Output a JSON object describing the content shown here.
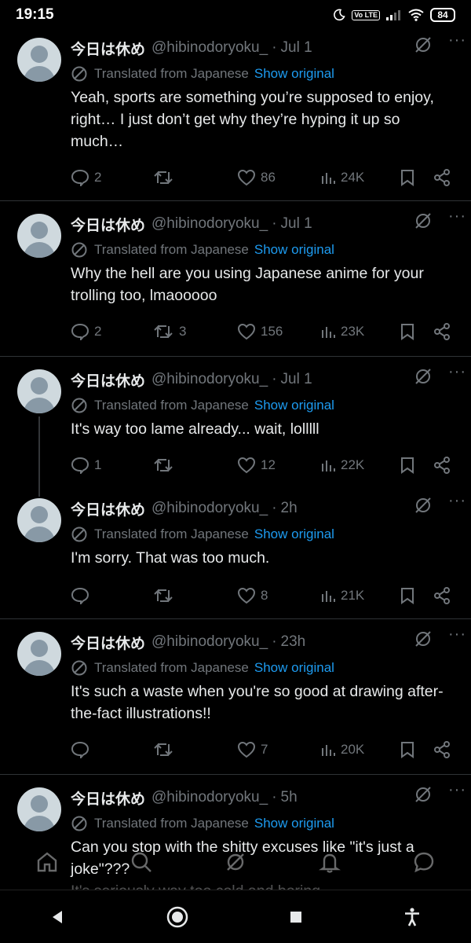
{
  "status_bar": {
    "time": "19:15",
    "volte": "Vo LTE",
    "battery": "84"
  },
  "tweets": [
    {
      "name": "今日は休め",
      "handle": "@hibinodoryoku_",
      "time": "Jul 1",
      "translated": "Translated from Japanese",
      "show_original": "Show original",
      "text": "Yeah, sports are something you’re supposed to enjoy, right… I just don’t get why they’re hyping it up so much…",
      "replies": "2",
      "retweets": "",
      "likes": "86",
      "views": "24K"
    },
    {
      "name": "今日は休め",
      "handle": "@hibinodoryoku_",
      "time": "Jul 1",
      "translated": "Translated from Japanese",
      "show_original": "Show original",
      "text": "Why the hell are you using Japanese anime for your trolling too, lmaooooo",
      "replies": "2",
      "retweets": "3",
      "likes": "156",
      "views": "23K"
    },
    {
      "name": "今日は休め",
      "handle": "@hibinodoryoku_",
      "time": "Jul 1",
      "translated": "Translated from Japanese",
      "show_original": "Show original",
      "text": "It's way too lame already... wait, lolllll",
      "replies": "1",
      "retweets": "",
      "likes": "12",
      "views": "22K"
    },
    {
      "name": "今日は休め",
      "handle": "@hibinodoryoku_",
      "time": "2h",
      "translated": "Translated from Japanese",
      "show_original": "Show original",
      "text": "I'm sorry. That was too much.",
      "replies": "",
      "retweets": "",
      "likes": "8",
      "views": "21K"
    },
    {
      "name": "今日は休め",
      "handle": "@hibinodoryoku_",
      "time": "23h",
      "translated": "Translated from Japanese",
      "show_original": "Show original",
      "text": "It's such a waste when you're so good at drawing after-the-fact illustrations!!",
      "replies": "",
      "retweets": "",
      "likes": "7",
      "views": "20K"
    },
    {
      "name": "今日は休め",
      "handle": "@hibinodoryoku_",
      "time": "5h",
      "translated": "Translated from Japanese",
      "show_original": "Show original",
      "text": "Can you stop with the shitty excuses like \"it's just a joke\"???",
      "text_cut": "It's seriously way too cold and boring"
    }
  ],
  "icons": {
    "grok": "grok-icon",
    "more": "more-icon",
    "translate": "translate-icon",
    "reply": "reply-icon",
    "retweet": "retweet-icon",
    "like": "heart-icon",
    "views": "views-icon",
    "bookmark": "bookmark-icon",
    "share": "share-icon"
  },
  "colors": {
    "background": "#000000",
    "link": "#1d9bf0",
    "muted": "#71767b",
    "text": "#e7e9ea"
  }
}
